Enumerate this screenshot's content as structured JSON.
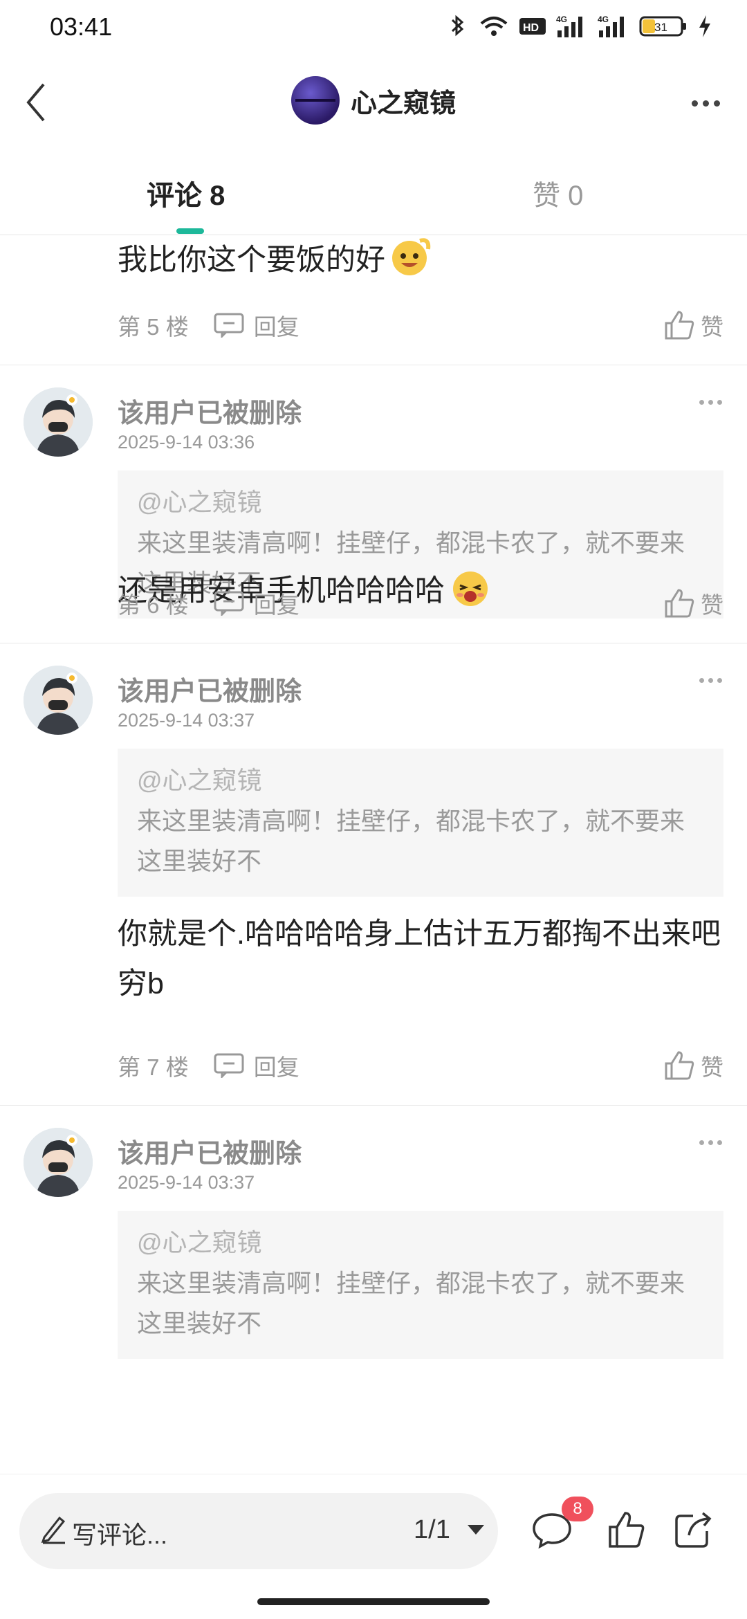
{
  "status_bar": {
    "time": "03:41",
    "battery": "31",
    "network_1": "4G",
    "network_2": "4G",
    "hd": "HD"
  },
  "header": {
    "title": "心之窥镜"
  },
  "tabs": {
    "comments": "评论 8",
    "likes": "赞 0"
  },
  "colors": {
    "accent": "#1db89a",
    "badge": "#f0505c"
  },
  "comments": [
    {
      "text": "我比你这个要饭的好",
      "emoji": "grinning-emoji",
      "floor": "第 5 楼",
      "reply_label": "回复",
      "like_label": "赞"
    },
    {
      "user": "该用户已被删除",
      "date": "2025-9-14 03:36",
      "quote_user": "@心之窥镜",
      "quote_text": "来这里装清高啊！挂壁仔，都混卡农了，就不要来这里装好不",
      "text": "还是用安卓手机哈哈哈哈",
      "emoji": "laughing-emoji",
      "floor": "第 6 楼",
      "reply_label": "回复",
      "like_label": "赞"
    },
    {
      "user": "该用户已被删除",
      "date": "2025-9-14 03:37",
      "quote_user": "@心之窥镜",
      "quote_text": "来这里装清高啊！挂壁仔，都混卡农了，就不要来这里装好不",
      "text": "你就是个.哈哈哈哈身上估计五万都掏不出来吧穷b",
      "floor": "第 7 楼",
      "reply_label": "回复",
      "like_label": "赞"
    },
    {
      "user": "该用户已被删除",
      "date": "2025-9-14 03:37",
      "quote_user": "@心之窥镜",
      "quote_text": "来这里装清高啊！挂壁仔，都混卡农了，就不要来这里装好不"
    }
  ],
  "bottom_bar": {
    "write_placeholder": "写评论...",
    "page": "1/1",
    "comment_count": "8"
  }
}
